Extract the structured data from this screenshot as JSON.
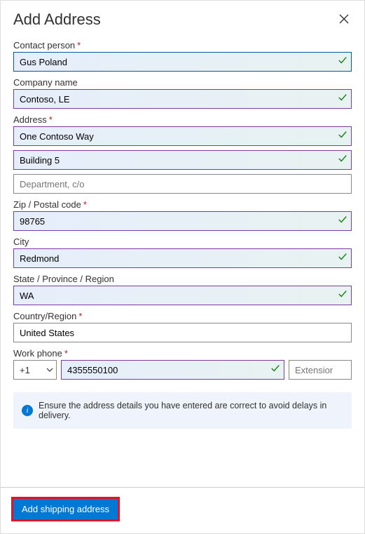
{
  "title": "Add Address",
  "fields": {
    "contact_person": {
      "label": "Contact person",
      "required": true,
      "value": "Gus Poland"
    },
    "company_name": {
      "label": "Company name",
      "value": "Contoso, LE"
    },
    "address": {
      "label": "Address",
      "required": true,
      "line1": "One Contoso Way",
      "line2": "Building 5",
      "line3_placeholder": "Department, c/o"
    },
    "zip": {
      "label": "Zip / Postal code",
      "required": true,
      "value": "98765"
    },
    "city": {
      "label": "City",
      "value": "Redmond"
    },
    "state": {
      "label": "State / Province / Region",
      "value": "WA"
    },
    "country": {
      "label": "Country/Region",
      "required": true,
      "value": "United States"
    },
    "phone": {
      "label": "Work phone",
      "required": true,
      "country_code": "+1",
      "number": "4355550100",
      "ext_placeholder": "Extension"
    }
  },
  "info_message": "Ensure the address details you have entered are correct to avoid delays in delivery.",
  "submit_label": "Add shipping address"
}
